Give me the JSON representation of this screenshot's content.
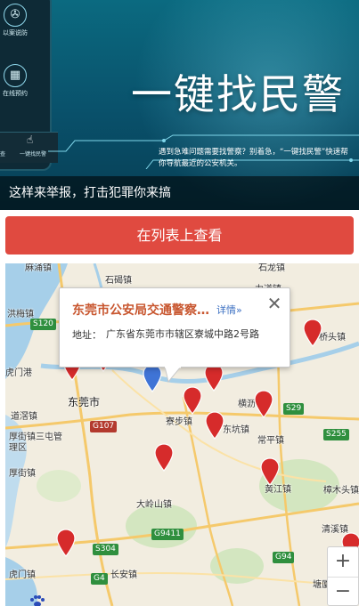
{
  "banner": {
    "title": "一键找民警",
    "description": "遇到急难问题需要找警察？别着急，“一键找民警”快速帮你导航最近的公安机关。",
    "caption": "这样来举报，打击犯罪你来搞",
    "phone_items": [
      {
        "label": "以案说防",
        "icon": "film-reel-icon"
      },
      {
        "label": "在线预约",
        "icon": "calendar-icon"
      }
    ],
    "bar_left_label": "查",
    "bar_right_label": "一键找民警"
  },
  "list_button_label": "在列表上查看",
  "map": {
    "popup": {
      "title": "东莞市公安局交通警察…",
      "detail_link": "详情»",
      "address_label": "地址：",
      "address": "广东省东莞市市辖区寮城中路2号路"
    },
    "places": [
      {
        "name": "麻涌镇",
        "big": false
      },
      {
        "name": "洪梅镇",
        "big": false
      },
      {
        "name": "石碣镇",
        "big": false
      },
      {
        "name": "石龙镇",
        "big": false
      },
      {
        "name": "虎门港",
        "big": false
      },
      {
        "name": "东莞市",
        "big": true
      },
      {
        "name": "道滘镇",
        "big": false
      },
      {
        "name": "厚街镇三屯管理区",
        "big": false
      },
      {
        "name": "厚街镇",
        "big": false
      },
      {
        "name": "寮步镇",
        "big": false
      },
      {
        "name": "横沥镇",
        "big": false
      },
      {
        "name": "东坑镇",
        "big": false
      },
      {
        "name": "常平镇",
        "big": false
      },
      {
        "name": "大岭山镇",
        "big": false
      },
      {
        "name": "黄江镇",
        "big": false
      },
      {
        "name": "樟木头镇",
        "big": false
      },
      {
        "name": "长安镇",
        "big": false
      },
      {
        "name": "虎门镇",
        "big": false
      },
      {
        "name": "塘厦镇",
        "big": false
      },
      {
        "name": "清溪镇",
        "big": false
      },
      {
        "name": "力道镇",
        "big": false
      },
      {
        "name": "桥头镇",
        "big": false
      }
    ],
    "road_shields": [
      {
        "label": "S120",
        "color": "green"
      },
      {
        "label": "G107",
        "color": "red"
      },
      {
        "label": "S29",
        "color": "green"
      },
      {
        "label": "S255",
        "color": "green"
      },
      {
        "label": "G9411",
        "color": "green"
      },
      {
        "label": "S304",
        "color": "green"
      },
      {
        "label": "G4",
        "color": "green"
      },
      {
        "label": "G94",
        "color": "green"
      }
    ],
    "zoom_in": "+",
    "zoom_out": "−",
    "colors": {
      "pin": "#d62b2b",
      "selected_pin": "#3f74d6",
      "water": "#a6cfe9",
      "road": "#f5c96b"
    }
  }
}
